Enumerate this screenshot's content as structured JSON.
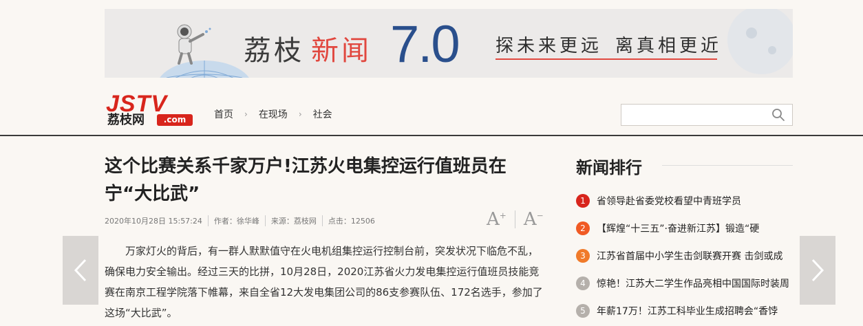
{
  "banner": {
    "brand_part1": "荔枝",
    "brand_part2": "新闻",
    "version": "7.0",
    "slogan1": "探未来更远",
    "slogan2": "离真相更近"
  },
  "header": {
    "logo_main": "JSTV",
    "logo_cn": "荔枝网",
    "logo_com": ".com",
    "breadcrumb": [
      "首页",
      "在现场",
      "社会"
    ],
    "search_placeholder": ""
  },
  "article": {
    "title": "这个比赛关系千家万户!江苏火电集控运行值班员在宁“大比武”",
    "date": "2020年10月28日 15:57:24",
    "author": "作者：徐华峰",
    "source": "来源：荔枝网",
    "clicks": "点击：12506",
    "font_increase": "A",
    "font_increase_sign": "+",
    "font_decrease": "A",
    "font_decrease_sign": "−",
    "paragraph": "万家灯火的背后，有一群人默默值守在火电机组集控运行控制台前，突发状况下临危不乱，确保电力安全输出。经过三天的比拼，10月28日，2020江苏省火力发电集控运行值班员技能竞赛在南京工程学院落下帷幕，来自全省12大发电集团公司的86支参赛队伍、172名选手，参加了这场“大比武”。"
  },
  "ranking": {
    "title": "新闻排行",
    "items": [
      {
        "num": "1",
        "text": "省领导赴省委党校看望中青班学员",
        "color": "#d8251c"
      },
      {
        "num": "2",
        "text": "【辉煌“十三五”·奋进新江苏】锻造“硬",
        "color": "#f05a24"
      },
      {
        "num": "3",
        "text": "江苏省首届中小学生击剑联赛开赛 击剑或成",
        "color": "#f07a2a"
      },
      {
        "num": "4",
        "text": "惊艳！江苏大二学生作品亮相中国国际时装周",
        "color": "#b5b0ab"
      },
      {
        "num": "5",
        "text": "年薪17万！江苏工科毕业生成招聘会“香饽",
        "color": "#b5b0ab"
      }
    ]
  },
  "colors": {
    "accent_red": "#d8251c",
    "banner_blue": "#2a4f8c",
    "divider": "#3a3a3a"
  },
  "icons": {
    "search": "search-icon",
    "prev": "chevron-left-icon",
    "next": "chevron-right-icon"
  }
}
